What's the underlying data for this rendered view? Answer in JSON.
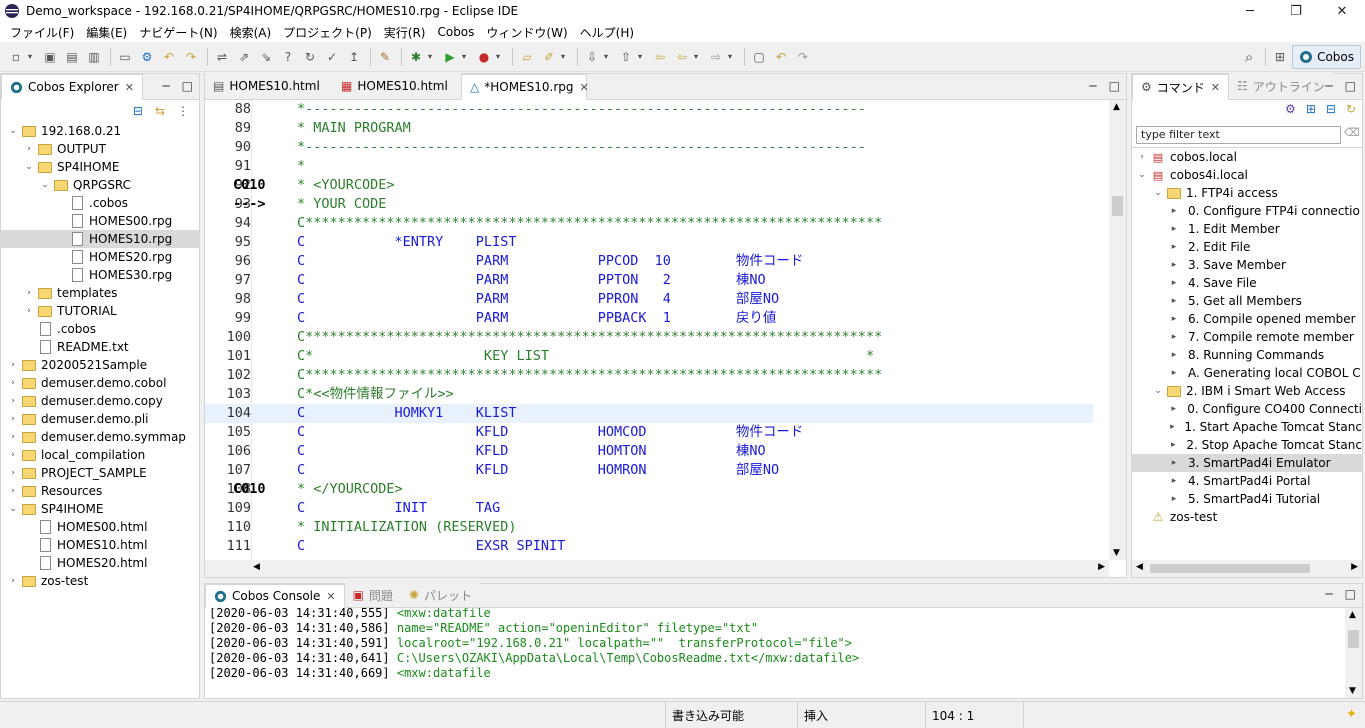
{
  "window": {
    "title": "Demo_workspace - 192.168.0.21/SP4IHOME/QRPGSRC/HOMES10.rpg - Eclipse IDE",
    "minimize": "─",
    "restore": "❐",
    "close": "✕"
  },
  "menu": [
    "ファイル(F)",
    "編集(E)",
    "ナビゲート(N)",
    "検索(A)",
    "プロジェクト(P)",
    "実行(R)",
    "Cobos",
    "ウィンドウ(W)",
    "ヘルプ(H)"
  ],
  "toolbar": {
    "perspective": "Cobos"
  },
  "explorer": {
    "tab": "Cobos Explorer",
    "items": [
      {
        "label": "192.168.0.21",
        "depth": 0,
        "tog": "⌄",
        "icon": "folder"
      },
      {
        "label": "OUTPUT",
        "depth": 1,
        "tog": "›",
        "icon": "folder"
      },
      {
        "label": "SP4IHOME",
        "depth": 1,
        "tog": "⌄",
        "icon": "folder"
      },
      {
        "label": "QRPGSRC",
        "depth": 2,
        "tog": "⌄",
        "icon": "folder"
      },
      {
        "label": ".cobos",
        "depth": 3,
        "tog": "",
        "icon": "file"
      },
      {
        "label": "HOMES00.rpg",
        "depth": 3,
        "tog": "",
        "icon": "file"
      },
      {
        "label": "HOMES10.rpg",
        "depth": 3,
        "tog": "",
        "icon": "file",
        "selected": true
      },
      {
        "label": "HOMES20.rpg",
        "depth": 3,
        "tog": "",
        "icon": "file"
      },
      {
        "label": "HOMES30.rpg",
        "depth": 3,
        "tog": "",
        "icon": "file"
      },
      {
        "label": "templates",
        "depth": 1,
        "tog": "›",
        "icon": "folder"
      },
      {
        "label": "TUTORIAL",
        "depth": 1,
        "tog": "›",
        "icon": "folder"
      },
      {
        "label": ".cobos",
        "depth": 1,
        "tog": "",
        "icon": "file"
      },
      {
        "label": "README.txt",
        "depth": 1,
        "tog": "",
        "icon": "file"
      },
      {
        "label": "20200521Sample",
        "depth": 0,
        "tog": "›",
        "icon": "folder"
      },
      {
        "label": "demuser.demo.cobol",
        "depth": 0,
        "tog": "›",
        "icon": "folder"
      },
      {
        "label": "demuser.demo.copy",
        "depth": 0,
        "tog": "›",
        "icon": "folder"
      },
      {
        "label": "demuser.demo.pli",
        "depth": 0,
        "tog": "›",
        "icon": "folder"
      },
      {
        "label": "demuser.demo.symmap",
        "depth": 0,
        "tog": "›",
        "icon": "folder"
      },
      {
        "label": "local_compilation",
        "depth": 0,
        "tog": "›",
        "icon": "folder"
      },
      {
        "label": "PROJECT_SAMPLE",
        "depth": 0,
        "tog": "›",
        "icon": "folder"
      },
      {
        "label": "Resources",
        "depth": 0,
        "tog": "›",
        "icon": "folder"
      },
      {
        "label": "SP4IHOME",
        "depth": 0,
        "tog": "⌄",
        "icon": "folder"
      },
      {
        "label": "HOMES00.html",
        "depth": 1,
        "tog": "",
        "icon": "file"
      },
      {
        "label": "HOMES10.html",
        "depth": 1,
        "tog": "",
        "icon": "file"
      },
      {
        "label": "HOMES20.html",
        "depth": 1,
        "tog": "",
        "icon": "file"
      },
      {
        "label": "zos-test",
        "depth": 0,
        "tog": "›",
        "icon": "folder"
      }
    ]
  },
  "editor": {
    "tabs": [
      {
        "label": "HOMES10.html",
        "active": false
      },
      {
        "label": "HOMES10.html",
        "active": false
      },
      {
        "label": "*HOMES10.rpg",
        "active": true
      }
    ],
    "lines": [
      {
        "n": "88",
        "p": "",
        "t": "*---------------------------------------------------------------------",
        "c": "cm"
      },
      {
        "n": "89",
        "p": "",
        "t": "* MAIN PROGRAM",
        "c": "cm"
      },
      {
        "n": "90",
        "p": "",
        "t": "*---------------------------------------------------------------------",
        "c": "cm"
      },
      {
        "n": "91",
        "p": "",
        "t": "*",
        "c": "cm"
      },
      {
        "n": "92",
        "p": "C010",
        "t": "* <YOURCODE>",
        "c": "cm"
      },
      {
        "n": "93",
        "p": "--->",
        "t": "* YOUR CODE",
        "c": "cm"
      },
      {
        "n": "94",
        "p": "",
        "t": "C***********************************************************************",
        "c": "cm"
      },
      {
        "n": "95",
        "p": "",
        "t": "C           *ENTRY    PLIST",
        "c": "kw"
      },
      {
        "n": "96",
        "p": "",
        "t": "C                     PARM           PPCOD  10        物件コード",
        "c": "kw"
      },
      {
        "n": "97",
        "p": "",
        "t": "C                     PARM           PPTON   2        棟NO",
        "c": "kw"
      },
      {
        "n": "98",
        "p": "",
        "t": "C                     PARM           PPRON   4        部屋NO",
        "c": "kw"
      },
      {
        "n": "99",
        "p": "",
        "t": "C                     PARM           PPBACK  1        戻り値",
        "c": "kw"
      },
      {
        "n": "100",
        "p": "",
        "t": "C***********************************************************************",
        "c": "cm"
      },
      {
        "n": "101",
        "p": "",
        "t": "C*                     KEY LIST                                       *",
        "c": "cm"
      },
      {
        "n": "102",
        "p": "",
        "t": "C***********************************************************************",
        "c": "cm"
      },
      {
        "n": "103",
        "p": "",
        "t": "C*<<物件情報ファイル>>",
        "c": "cm"
      },
      {
        "n": "104",
        "p": "",
        "t": "C           HOMKY1    KLIST",
        "c": "kw",
        "cur": true
      },
      {
        "n": "105",
        "p": "",
        "t": "C                     KFLD           HOMCOD           物件コード",
        "c": "kw"
      },
      {
        "n": "106",
        "p": "",
        "t": "C                     KFLD           HOMTON           棟NO",
        "c": "kw"
      },
      {
        "n": "107",
        "p": "",
        "t": "C                     KFLD           HOMRON           部屋NO",
        "c": "kw"
      },
      {
        "n": "108",
        "p": "C010",
        "t": "* </YOURCODE>",
        "c": "cm"
      },
      {
        "n": "109",
        "p": "",
        "t": "C           INIT      TAG",
        "c": "kw"
      },
      {
        "n": "110",
        "p": "",
        "t": "* INITIALIZATION (RESERVED)",
        "c": "cm"
      },
      {
        "n": "111",
        "p": "",
        "t": "C                     EXSR SPINIT",
        "c": "kw"
      }
    ]
  },
  "commands": {
    "tab": "コマンド",
    "tab2": "アウトライン",
    "filter_value": "type filter text",
    "items": [
      {
        "label": "cobos.local",
        "depth": 0,
        "tog": "›",
        "icon": "x"
      },
      {
        "label": "cobos4i.local",
        "depth": 0,
        "tog": "⌄",
        "icon": "x"
      },
      {
        "label": "1. FTP4i access",
        "depth": 1,
        "tog": "⌄",
        "icon": "folder"
      },
      {
        "label": "0. Configure FTP4i connectio",
        "depth": 2,
        "tog": "▸",
        "icon": ""
      },
      {
        "label": "1. Edit Member",
        "depth": 2,
        "tog": "▸",
        "icon": ""
      },
      {
        "label": "2. Edit File",
        "depth": 2,
        "tog": "▸",
        "icon": ""
      },
      {
        "label": "3. Save Member",
        "depth": 2,
        "tog": "▸",
        "icon": ""
      },
      {
        "label": "4. Save File",
        "depth": 2,
        "tog": "▸",
        "icon": ""
      },
      {
        "label": "5. Get all Members",
        "depth": 2,
        "tog": "▸",
        "icon": ""
      },
      {
        "label": "6. Compile opened member",
        "depth": 2,
        "tog": "▸",
        "icon": ""
      },
      {
        "label": "7. Compile remote member",
        "depth": 2,
        "tog": "▸",
        "icon": ""
      },
      {
        "label": "8. Running Commands",
        "depth": 2,
        "tog": "▸",
        "icon": ""
      },
      {
        "label": "A. Generating local COBOL C",
        "depth": 2,
        "tog": "▸",
        "icon": ""
      },
      {
        "label": "2. IBM i Smart Web Access",
        "depth": 1,
        "tog": "⌄",
        "icon": "folder"
      },
      {
        "label": "0. Configure CO400 Connecti",
        "depth": 2,
        "tog": "▸",
        "icon": ""
      },
      {
        "label": "1. Start Apache Tomcat Stanc",
        "depth": 2,
        "tog": "▸",
        "icon": ""
      },
      {
        "label": "2. Stop Apache Tomcat Stanc",
        "depth": 2,
        "tog": "▸",
        "icon": ""
      },
      {
        "label": "3. SmartPad4i Emulator",
        "depth": 2,
        "tog": "▸",
        "icon": "",
        "selected": true
      },
      {
        "label": "4. SmartPad4i Portal",
        "depth": 2,
        "tog": "▸",
        "icon": ""
      },
      {
        "label": "5. SmartPad4i Tutorial",
        "depth": 2,
        "tog": "▸",
        "icon": ""
      },
      {
        "label": "zos-test",
        "depth": 0,
        "tog": "",
        "icon": "warn"
      }
    ]
  },
  "console": {
    "tabs": [
      "Cobos Console",
      "問題",
      "パレット"
    ],
    "lines": [
      {
        "ts": "[2020-06-03 14:31:40,555]",
        "msg": " <mxw:datafile"
      },
      {
        "ts": "[2020-06-03 14:31:40,586]",
        "msg": " name=\"README\" action=\"openinEditor\" filetype=\"txt\""
      },
      {
        "ts": "[2020-06-03 14:31:40,591]",
        "msg": " localroot=\"192.168.0.21\" localpath=\"\"  transferProtocol=\"file\">"
      },
      {
        "ts": "[2020-06-03 14:31:40,641]",
        "msg": " C:\\Users\\OZAKI\\AppData\\Local\\Temp\\CobosReadme.txt</mxw:datafile>"
      },
      {
        "ts": "[2020-06-03 14:31:40,669]",
        "msg": " <mxw:datafile"
      }
    ]
  },
  "statusbar": {
    "writable": "書き込み可能",
    "insert": "挿入",
    "position": "104 : 1"
  }
}
